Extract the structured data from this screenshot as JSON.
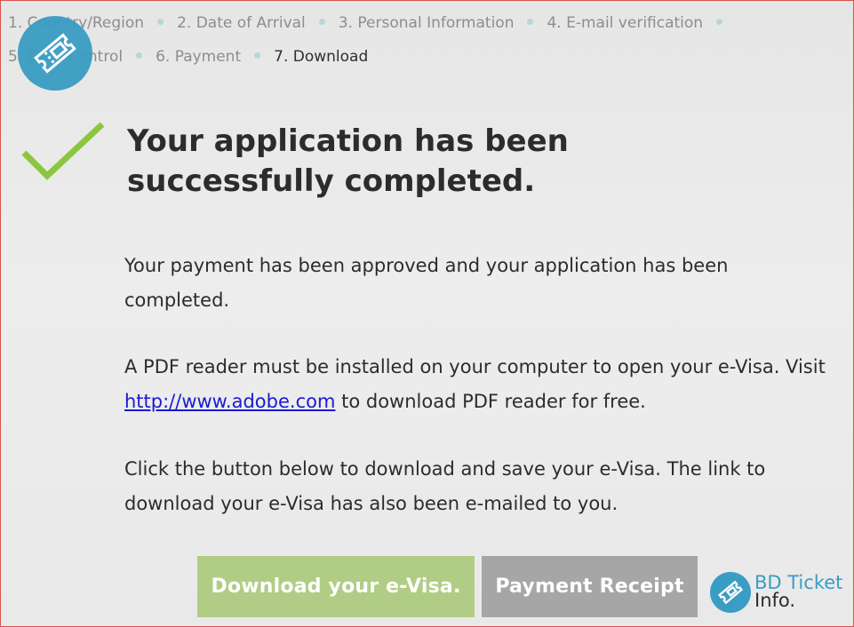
{
  "steps": [
    {
      "label": "1. Country/Region"
    },
    {
      "label": "2. Date of Arrival"
    },
    {
      "label": "3. Personal Information"
    },
    {
      "label": "4. E-mail verification"
    },
    {
      "label": "5. Data Control"
    },
    {
      "label": "6. Payment"
    },
    {
      "label": "7. Download"
    }
  ],
  "active_step": 7,
  "heading": "Your application has been successfully completed.",
  "payment_text": "Your payment has been approved and your application has been completed.",
  "pdf": {
    "before": "A PDF reader must be installed on your computer to open your e-Visa. Visit ",
    "link": "http://www.adobe.com",
    "after": " to download PDF reader for free."
  },
  "download_text": "Click the button below to download and save your e-Visa. The link to download your e-Visa has also been e-mailed to you.",
  "buttons": {
    "download": "Download your e-Visa.",
    "receipt": "Payment Receipt"
  },
  "watermark": {
    "line1": "BD Ticket",
    "line2": "Info."
  },
  "colors": {
    "check": "#8cc63f",
    "download_button": "#b1cd85",
    "receipt_button": "#a6a6a6",
    "link": "#1a1ad4",
    "brand": "#3a9dc4"
  },
  "icons": [
    "check-icon",
    "ticket-logo-icon"
  ]
}
